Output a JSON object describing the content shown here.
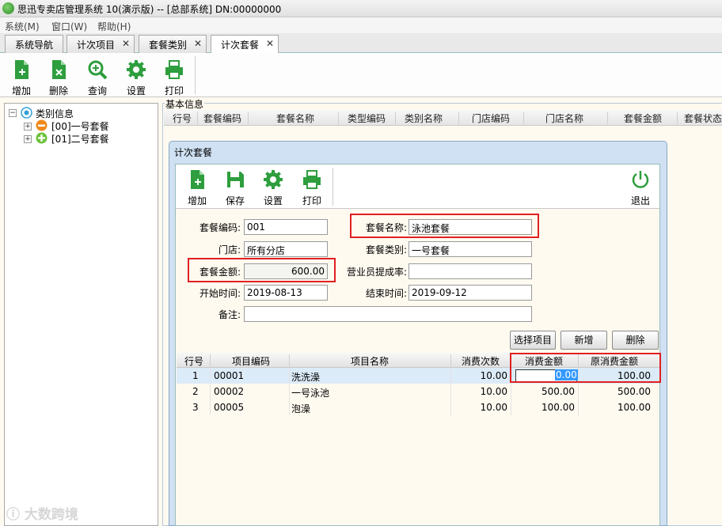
{
  "window": {
    "title": "思迅专卖店管理系统 10(演示版) -- [总部系统] DN:00000000"
  },
  "menu": [
    "系统(M)",
    "窗口(W)",
    "帮助(H)"
  ],
  "tabs": [
    {
      "label": "系统导航",
      "closable": false
    },
    {
      "label": "计次项目",
      "closable": true
    },
    {
      "label": "套餐类别",
      "closable": true
    },
    {
      "label": "计次套餐",
      "closable": true,
      "active": true
    }
  ],
  "toolbar": {
    "add": "增加",
    "delete": "删除",
    "query": "查询",
    "settings": "设置",
    "print": "打印"
  },
  "tree": {
    "root": "类别信息",
    "items": [
      {
        "label": "[00]一号套餐"
      },
      {
        "label": "[01]二号套餐"
      }
    ]
  },
  "basic": {
    "legend": "基本信息",
    "columns": [
      "行号",
      "套餐编码",
      "套餐名称",
      "类型编码",
      "类别名称",
      "门店编码",
      "门店名称",
      "套餐金额",
      "套餐状态"
    ]
  },
  "dialog": {
    "title": "计次套餐",
    "toolbar": {
      "add": "增加",
      "save": "保存",
      "settings": "设置",
      "print": "打印",
      "exit": "退出"
    },
    "form": {
      "code_label": "套餐编码:",
      "code": "001",
      "name_label": "套餐名称:",
      "name": "泳池套餐",
      "store_label": "门店:",
      "store": "所有分店",
      "category_label": "套餐类别:",
      "category": "一号套餐",
      "amount_label": "套餐金额:",
      "amount": "600.00",
      "commission_label": "营业员提成率:",
      "commission": "",
      "start_label": "开始时间:",
      "start": "2019-08-13",
      "end_label": "结束时间:",
      "end": "2019-09-12",
      "memo_label": "备注:",
      "memo": ""
    },
    "buttons": {
      "select": "选择项目",
      "new": "新增",
      "delete": "删除"
    },
    "detail": {
      "columns": [
        "行号",
        "项目编码",
        "项目名称",
        "消费次数",
        "消费金额",
        "原消费金额"
      ],
      "rows": [
        {
          "no": "1",
          "code": "00001",
          "name": "洗洗澡",
          "times": "10.00",
          "amount": "0.00",
          "orig": "100.00"
        },
        {
          "no": "2",
          "code": "00002",
          "name": "一号泳池",
          "times": "10.00",
          "amount": "500.00",
          "orig": "500.00"
        },
        {
          "no": "3",
          "code": "00005",
          "name": "泡澡",
          "times": "10.00",
          "amount": "100.00",
          "orig": "100.00"
        }
      ]
    }
  },
  "watermark": "大数跨境",
  "colors": {
    "icon_green": "#2e9e3e",
    "highlight_red": "#e02020",
    "selection_blue": "#3399ff",
    "dialog_blue": "#cfe1f3"
  }
}
